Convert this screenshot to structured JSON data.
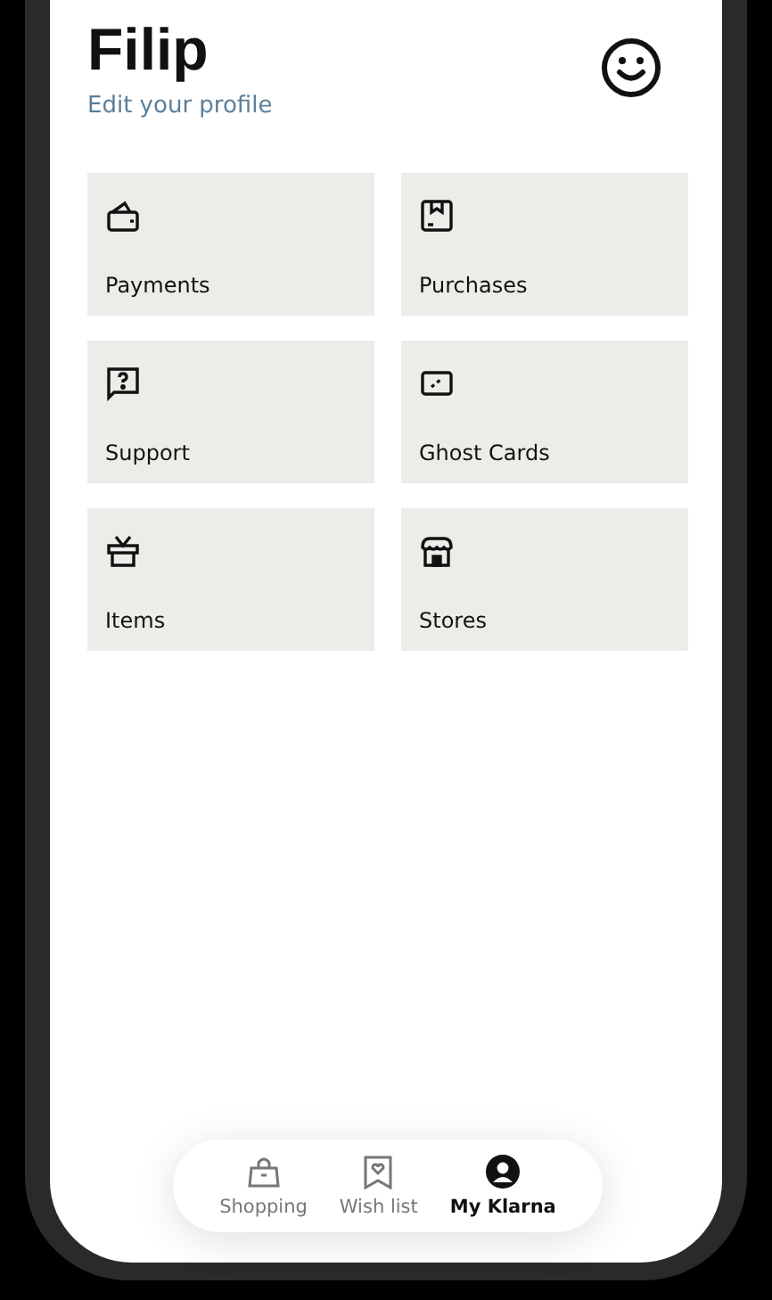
{
  "profile": {
    "name": "Filip",
    "edit_link": "Edit your profile"
  },
  "tiles": [
    {
      "label": "Payments",
      "kind": "wallet"
    },
    {
      "label": "Purchases",
      "kind": "box"
    },
    {
      "label": "Support",
      "kind": "support"
    },
    {
      "label": "Ghost Cards",
      "kind": "card"
    },
    {
      "label": "Items",
      "kind": "gift"
    },
    {
      "label": "Stores",
      "kind": "store"
    }
  ],
  "bottom_nav": [
    {
      "label": "Shopping",
      "kind": "bag",
      "selected": false
    },
    {
      "label": "Wish list",
      "kind": "wish",
      "selected": false
    },
    {
      "label": "My Klarna",
      "kind": "user",
      "selected": true
    }
  ]
}
